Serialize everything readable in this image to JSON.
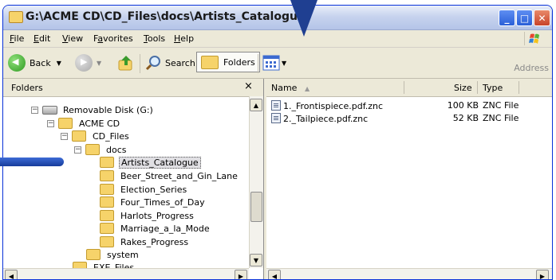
{
  "window": {
    "title": "G:\\ACME CD\\CD_Files\\docs\\Artists_Catalogue",
    "controls": {
      "minimize": "_",
      "maximize": "□",
      "close": "✕"
    }
  },
  "menubar": {
    "items": [
      {
        "label": "File",
        "hotkey": "F",
        "rest": "ile"
      },
      {
        "label": "Edit",
        "hotkey": "E",
        "rest": "dit"
      },
      {
        "label": "View",
        "hotkey": "V",
        "rest": "iew"
      },
      {
        "label": "Favorites",
        "hotkey": "a",
        "pre": "F",
        "rest": "vorites"
      },
      {
        "label": "Tools",
        "hotkey": "T",
        "rest": "ools"
      },
      {
        "label": "Help",
        "hotkey": "H",
        "rest": "elp"
      }
    ]
  },
  "toolbar": {
    "back_label": "Back",
    "search_label": "Search",
    "folders_label": "Folders",
    "address_label": "Address"
  },
  "folders_pane": {
    "header": "Folders",
    "close_glyph": "×",
    "tree": [
      {
        "label": "Removable Disk (G:)",
        "type": "disk",
        "expanded": true
      },
      {
        "label": "ACME CD",
        "type": "folder",
        "expanded": true
      },
      {
        "label": "CD_Files",
        "type": "folder",
        "expanded": true
      },
      {
        "label": "docs",
        "type": "folder",
        "expanded": true
      },
      {
        "label": "Artists_Catalogue",
        "type": "folder",
        "selected": true
      },
      {
        "label": "Beer_Street_and_Gin_Lane",
        "type": "folder"
      },
      {
        "label": "Election_Series",
        "type": "folder"
      },
      {
        "label": "Four_Times_of_Day",
        "type": "folder"
      },
      {
        "label": "Harlots_Progress",
        "type": "folder"
      },
      {
        "label": "Marriage_a_la_Mode",
        "type": "folder"
      },
      {
        "label": "Rakes_Progress",
        "type": "folder"
      },
      {
        "label": "system",
        "type": "folder"
      },
      {
        "label": "EXE_Files",
        "type": "folder"
      }
    ]
  },
  "file_list": {
    "columns": {
      "name": "Name",
      "size": "Size",
      "type": "Type"
    },
    "sort_glyph": "▲",
    "rows": [
      {
        "name": "1._Frontispiece.pdf.znc",
        "size": "100 KB",
        "type": "ZNC File"
      },
      {
        "name": "2._Tailpiece.pdf.znc",
        "size": "52 KB",
        "type": "ZNC File"
      }
    ]
  },
  "colors": {
    "marker": "#1f3f91",
    "selection_outline": "#555555",
    "folder": "#f6d36a"
  }
}
